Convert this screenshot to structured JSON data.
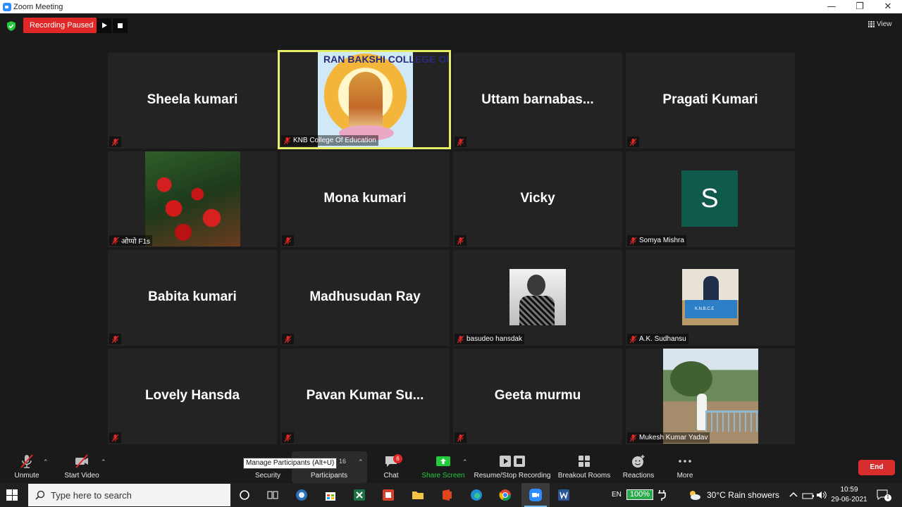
{
  "window": {
    "title": "Zoom Meeting",
    "controls": [
      "—",
      "❐",
      "✕"
    ]
  },
  "recording": {
    "status": "Recording Paused"
  },
  "view": {
    "label": "View"
  },
  "tiles": {
    "sheela": {
      "name": "Sheela kumari"
    },
    "knb": {
      "label": "KNB College Of Education",
      "photo_text": "RAN BAKSHI COLLEGE OF E"
    },
    "uttam": {
      "name": "Uttam  barnabas..."
    },
    "pragati": {
      "name": "Pragati Kumari"
    },
    "oppo": {
      "label": "ओप्पो F1s"
    },
    "mona": {
      "name": "Mona kumari"
    },
    "vicky": {
      "name": "Vicky"
    },
    "somya": {
      "avatar_letter": "S",
      "label": "Somya Mishra"
    },
    "babita": {
      "name": "Babita kumari"
    },
    "madhusudan": {
      "name": "Madhusudan Ray"
    },
    "basudeo": {
      "label": "basudeo hansdak"
    },
    "aksudhansu": {
      "label": "A.K. Sudhansu",
      "photo_text": "K.N.B.C.E"
    },
    "lovely": {
      "name": "Lovely Hansda"
    },
    "pavan": {
      "name": "Pavan  Kumar Su..."
    },
    "geeta": {
      "name": "Geeta murmu"
    },
    "mukesh": {
      "label": "Mukesh Kumar Yadav"
    }
  },
  "toolbar": {
    "unmute": "Unmute",
    "start_video": "Start Video",
    "security": "Security",
    "participants": "Participants",
    "participants_count": "16",
    "tooltip": "Manage Participants (Alt+U)",
    "chat": "Chat",
    "chat_badge": "6",
    "share_screen": "Share Screen",
    "recording": "Resume/Stop Recording",
    "breakout": "Breakout Rooms",
    "reactions": "Reactions",
    "more": "More",
    "end": "End"
  },
  "taskbar": {
    "search_placeholder": "Type here to search",
    "language": "EN",
    "battery": "100%",
    "weather": "30°C  Rain showers",
    "time": "10:59",
    "date": "29-06-2021",
    "notification_count": "1"
  },
  "colors": {
    "accent_blue": "#2d8cff",
    "recording_red": "#e02828",
    "active_speaker_border": "#e6ee6a",
    "share_green": "#25c93d",
    "end_red": "#d92c2c"
  }
}
